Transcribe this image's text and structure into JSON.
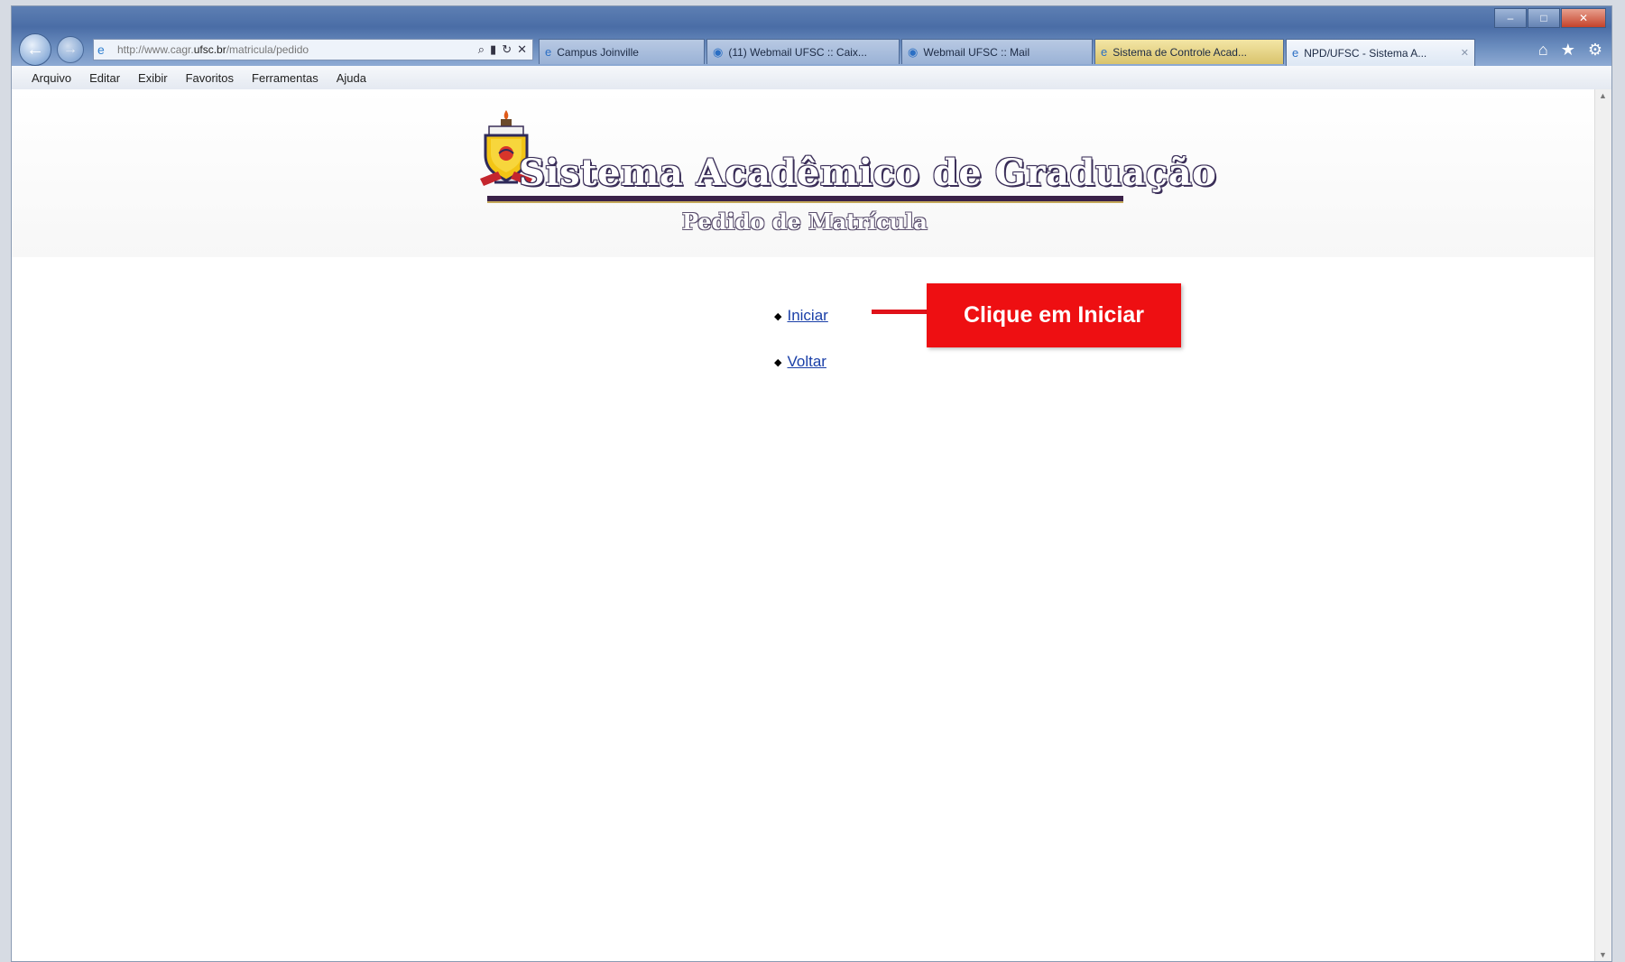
{
  "browser": {
    "address_url_prefix": "http://www.cagr.",
    "address_url_domain": "ufsc.br",
    "address_url_path": "/matricula/pedido",
    "tabs": [
      {
        "label": "Campus Joinville",
        "style": "blue"
      },
      {
        "label": "(11) Webmail UFSC :: Caix...",
        "style": "blue"
      },
      {
        "label": "Webmail UFSC :: Mail",
        "style": "blue"
      },
      {
        "label": "Sistema de Controle Acad...",
        "style": "yellow"
      },
      {
        "label": "NPD/UFSC - Sistema A...",
        "style": "active"
      }
    ],
    "menu": [
      "Arquivo",
      "Editar",
      "Exibir",
      "Favoritos",
      "Ferramentas",
      "Ajuda"
    ]
  },
  "page": {
    "title": "Sistema Acadêmico de Graduação",
    "subtitle": "Pedido de Matrícula",
    "links": {
      "start": "Iniciar",
      "back": "Voltar"
    }
  },
  "callout": {
    "text": "Clique em Iniciar",
    "color": "#ee0f12"
  }
}
